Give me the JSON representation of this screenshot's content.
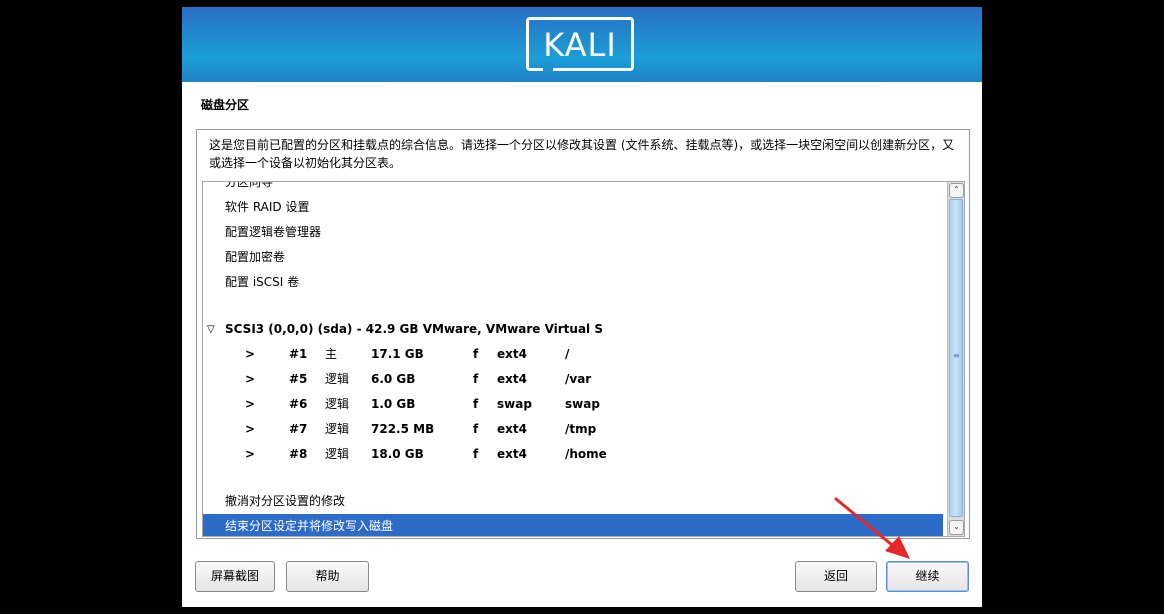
{
  "header": {
    "logo_text": "KALI"
  },
  "step_title": "磁盘分区",
  "instructions": "这是您目前已配置的分区和挂载点的综合信息。请选择一个分区以修改其设置 (文件系统、挂载点等)，或选择一块空闲空间以创建新分区，又或选择一个设备以初始化其分区表。",
  "list": {
    "partial_top": "分区向导",
    "menu_items": [
      "软件 RAID 设置",
      "配置逻辑卷管理器",
      "配置加密卷",
      "配置 iSCSI 卷"
    ],
    "disk": {
      "expand_glyph": "▽",
      "label": "SCSI3 (0,0,0) (sda) - 42.9 GB VMware, VMware Virtual S"
    },
    "partitions": [
      {
        "arrow": ">",
        "num": "#1",
        "type": "主",
        "size": "17.1 GB",
        "flag": "f",
        "fs": "ext4",
        "mount": "/"
      },
      {
        "arrow": ">",
        "num": "#5",
        "type": "逻辑",
        "size": "6.0 GB",
        "flag": "f",
        "fs": "ext4",
        "mount": "/var"
      },
      {
        "arrow": ">",
        "num": "#6",
        "type": "逻辑",
        "size": "1.0 GB",
        "flag": "f",
        "fs": "swap",
        "mount": "swap"
      },
      {
        "arrow": ">",
        "num": "#7",
        "type": "逻辑",
        "size": "722.5 MB",
        "flag": "f",
        "fs": "ext4",
        "mount": "/tmp"
      },
      {
        "arrow": ">",
        "num": "#8",
        "type": "逻辑",
        "size": "18.0 GB",
        "flag": "f",
        "fs": "ext4",
        "mount": "/home"
      }
    ],
    "undo": "撤消对分区设置的修改",
    "finish": "结束分区设定并将修改写入磁盘"
  },
  "scrollbar": {
    "up": "⌃",
    "down": "⌄",
    "grip": "≡"
  },
  "buttons": {
    "screenshot": "屏幕截图",
    "help": "帮助",
    "back": "返回",
    "continue": "继续"
  },
  "colors": {
    "selection": "#2c6bc7",
    "annotation_arrow": "#e8262a"
  }
}
